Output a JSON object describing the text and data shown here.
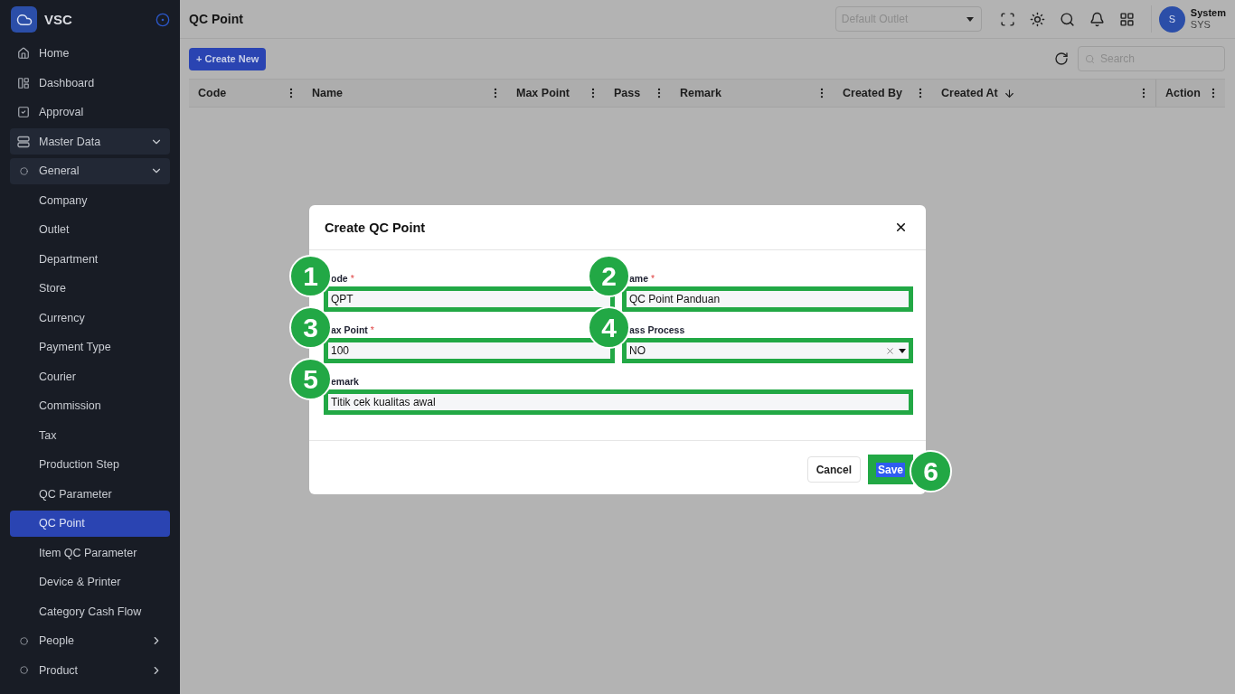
{
  "sidebar": {
    "brand": "VSC",
    "items": [
      {
        "label": "Home",
        "selected": false
      },
      {
        "label": "Dashboard",
        "selected": false
      },
      {
        "label": "Approval",
        "selected": false
      },
      {
        "label": "Master Data",
        "expanded": true,
        "children": [
          {
            "label": "General",
            "expanded": true,
            "children": [
              {
                "label": "Company",
                "selected": false
              },
              {
                "label": "Outlet",
                "selected": false
              },
              {
                "label": "Department",
                "selected": false
              },
              {
                "label": "Store",
                "selected": false
              },
              {
                "label": "Currency",
                "selected": false
              },
              {
                "label": "Payment Type",
                "selected": false
              },
              {
                "label": "Courier",
                "selected": false
              },
              {
                "label": "Commission",
                "selected": false
              },
              {
                "label": "Tax",
                "selected": false
              },
              {
                "label": "Production Step",
                "selected": false
              },
              {
                "label": "QC Parameter",
                "selected": false
              },
              {
                "label": "QC Point",
                "selected": true
              },
              {
                "label": "Item QC Parameter",
                "selected": false
              },
              {
                "label": "Device & Printer",
                "selected": false
              },
              {
                "label": "Category Cash Flow",
                "selected": false
              }
            ]
          },
          {
            "label": "People",
            "expanded": false
          },
          {
            "label": "Product",
            "expanded": false
          }
        ]
      }
    ]
  },
  "header": {
    "title": "QC Point",
    "outlet": {
      "placeholder": "Default Outlet"
    },
    "user": {
      "initial": "S",
      "name": "System",
      "code": "SYS"
    }
  },
  "toolbar": {
    "create_button": "+ Create New",
    "search": {
      "placeholder": "Search"
    }
  },
  "table": {
    "columns": [
      {
        "label": "Code",
        "sorted": false
      },
      {
        "label": "Name",
        "sorted": false
      },
      {
        "label": "Max Point",
        "sorted": false
      },
      {
        "label": "Pass",
        "sorted": false
      },
      {
        "label": "Remark",
        "sorted": false
      },
      {
        "label": "Created By",
        "sorted": false
      },
      {
        "label": "Created At",
        "sorted": true
      },
      {
        "label": "Action",
        "sorted": false
      }
    ]
  },
  "modal": {
    "title": "Create QC Point",
    "fields": [
      {
        "kind": "text",
        "label": "ode",
        "required_mark": "*",
        "value": "QPT",
        "callout": "1"
      },
      {
        "kind": "text",
        "label": "ame",
        "required_mark": "*",
        "value": "QC Point Panduan",
        "callout": "2"
      },
      {
        "kind": "text",
        "label": "ax Point",
        "required_mark": "*",
        "value": "100",
        "callout": "3"
      },
      {
        "kind": "select",
        "label": "ass Process",
        "value": "NO",
        "callout": "4"
      },
      {
        "kind": "text",
        "label": "emark",
        "value": "Titik cek kualitas awal",
        "callout": "5"
      }
    ],
    "cancel_button": "Cancel",
    "save_button": {
      "label": "Save",
      "callout": "6"
    }
  }
}
